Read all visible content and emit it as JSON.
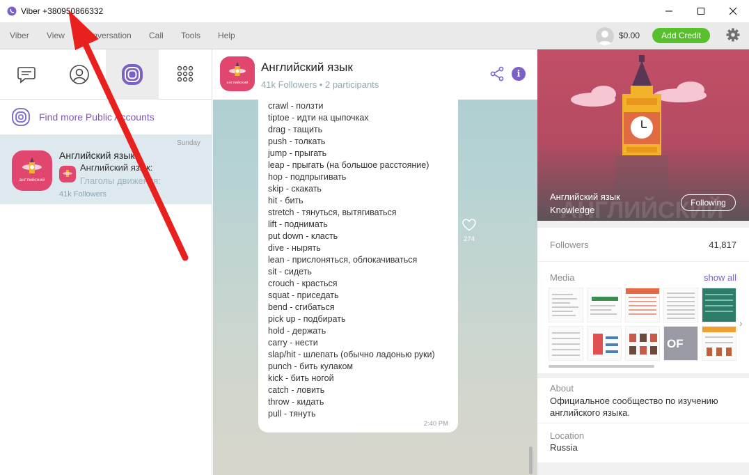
{
  "window": {
    "title": "Viber +380950866332",
    "controls": [
      "minimize-icon",
      "maximize-icon",
      "close-icon"
    ]
  },
  "menu": {
    "items": [
      "Viber",
      "View",
      "Conversation",
      "Call",
      "Tools",
      "Help"
    ],
    "balance": "$0.00",
    "add_credit": "Add Credit"
  },
  "left": {
    "tabs": [
      "chats-icon",
      "contacts-icon",
      "public-accounts-icon",
      "dialpad-icon"
    ],
    "active_tab": 2,
    "find_more": "Find more Public Accounts",
    "chat": {
      "name": "Английский язык",
      "date": "Sunday",
      "sender": "Английский язык:",
      "preview": "Глаголы движения:",
      "followers": "41k Followers"
    }
  },
  "chat": {
    "title": "Английский язык",
    "subtitle": "41k Followers • 2 participants",
    "message_lines": [
      "crawl - ползти",
      "tiptoe - идти на цыпочках",
      "drag - тащить",
      "push - толкать",
      "jump - прыгать",
      "leap - прыгать (на большое расстояние)",
      "hop - подпрыгивать",
      "skip - скакать",
      "hit - бить",
      "stretch - тянуться, вытягиваться",
      "lift - поднимать",
      "put down - класть",
      "dive - нырять",
      "lean - прислоняться, облокачиваться",
      "sit - сидеть",
      "crouch - красться",
      "squat - приседать",
      "bend - сгибаться",
      "pick up - подбирать",
      "hold - держать",
      "carry - нести",
      "slap/hit - шлепать (обычно ладонью руки)",
      "punch - бить кулаком",
      "kick - бить ногой",
      "catch - ловить",
      "throw - кидать",
      "pull - тянуть"
    ],
    "time": "2:40 PM",
    "likes": "274"
  },
  "info": {
    "name": "Английский язык",
    "category": "Knowledge",
    "cover_watermark": "АНГЛИЙСКИЙ",
    "following": "Following",
    "followers_label": "Followers",
    "followers_count": "41,817",
    "media_label": "Media",
    "show_all": "show all",
    "about_label": "About",
    "about_line1": "Официальное сообщество по изучению",
    "about_line2": "английского языка.",
    "location_label": "Location",
    "location": "Russia"
  },
  "colors": {
    "accent": "#7b61c6",
    "brand_pink": "#e0466e",
    "add_credit": "#58c02c",
    "annotation_arrow": "#e8211f"
  }
}
